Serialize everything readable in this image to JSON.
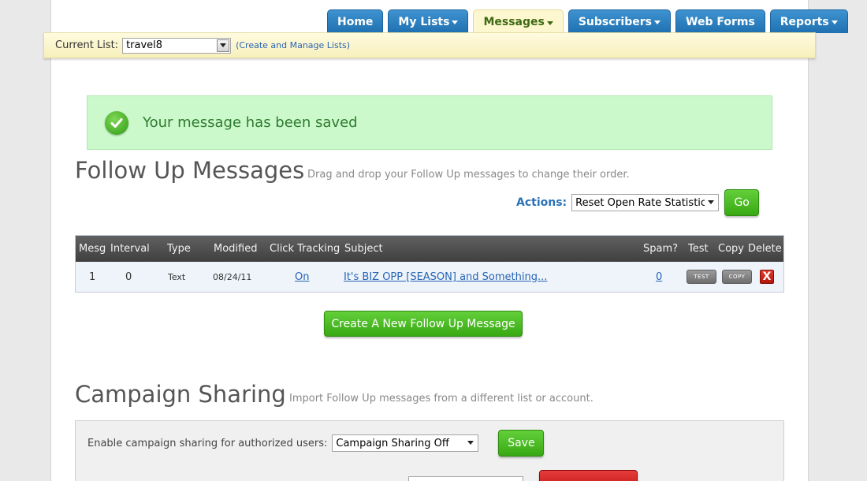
{
  "nav": {
    "tabs": [
      {
        "label": "Home",
        "dropdown": false,
        "active": false
      },
      {
        "label": "My Lists",
        "dropdown": true,
        "active": false
      },
      {
        "label": "Messages",
        "dropdown": true,
        "active": true
      },
      {
        "label": "Subscribers",
        "dropdown": true,
        "active": false
      },
      {
        "label": "Web Forms",
        "dropdown": false,
        "active": false
      },
      {
        "label": "Reports",
        "dropdown": true,
        "active": false
      }
    ]
  },
  "list_bar": {
    "label": "Current List:",
    "selected": "travel8",
    "manage_link": "(Create and Manage Lists)"
  },
  "alert": {
    "message": "Your message has been saved",
    "icon": "check-icon"
  },
  "follow_up": {
    "title": "Follow Up Messages",
    "subtitle": "Drag and drop your Follow Up messages to change their order.",
    "actions_label": "Actions:",
    "actions_selected": "Reset Open Rate Statistics",
    "go_label": "Go",
    "columns": [
      "Mesg",
      "Interval",
      "Type",
      "Modified",
      "Click Tracking",
      "Subject",
      "Spam?",
      "Test",
      "Copy",
      "Delete"
    ],
    "rows": [
      {
        "mesg": "1",
        "interval": "0",
        "type": "Text",
        "modified": "08/24/11",
        "click_tracking": "On",
        "subject": "It's BIZ OPP [SEASON] and Something...",
        "spam": "0",
        "test_label": "TEST",
        "copy_label": "COPY",
        "delete_label": "X"
      }
    ],
    "create_label": "Create A New Follow Up Message"
  },
  "sharing": {
    "title": "Campaign Sharing",
    "subtitle": "Import Follow Up messages from a different list or account.",
    "enable_label": "Enable campaign sharing for authorized users:",
    "enable_selected": "Campaign Sharing Off",
    "save_label": "Save"
  },
  "colors": {
    "tab_blue": "#2a7fc0",
    "tab_active_bg": "#fdf7cf",
    "success_bg": "#ccf9cc",
    "button_green": "#45b51f",
    "header_dark": "#4a4a4a",
    "link_blue": "#2864b4"
  }
}
